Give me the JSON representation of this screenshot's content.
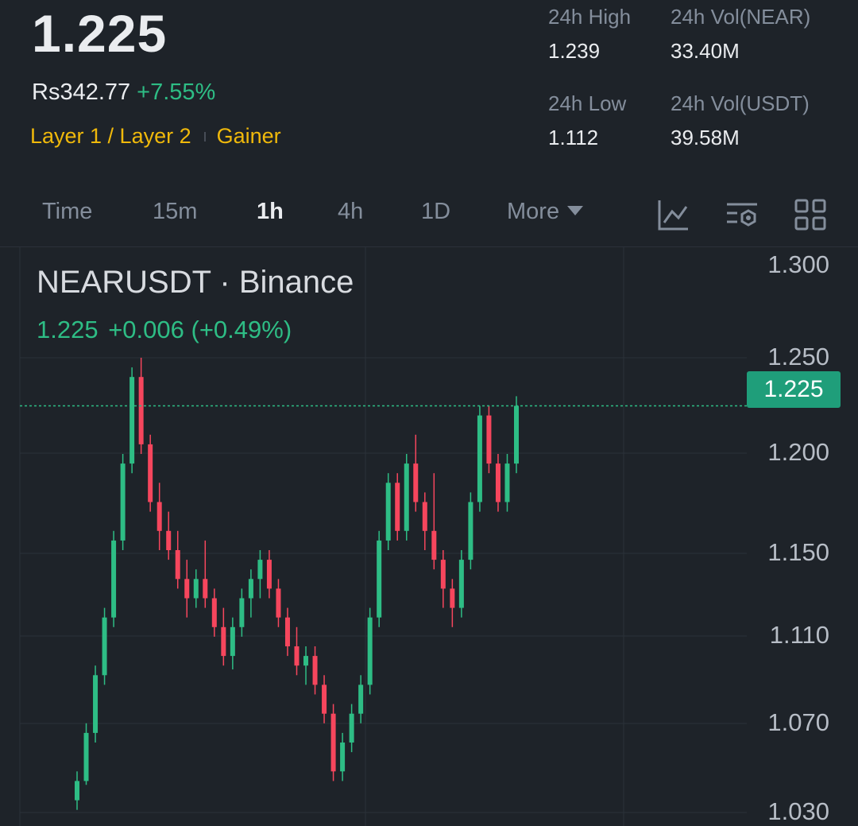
{
  "header": {
    "last_price": "1.225",
    "local_price": "Rs342.77",
    "change_pct": "+7.55%",
    "tag_1": "Layer 1 / Layer 2",
    "tag_2": "Gainer",
    "stats": {
      "high_label": "24h High",
      "high_value": "1.239",
      "vol_near_label": "24h Vol(NEAR)",
      "vol_near_value": "33.40M",
      "low_label": "24h Low",
      "low_value": "1.112",
      "vol_usdt_label": "24h Vol(USDT)",
      "vol_usdt_value": "39.58M"
    }
  },
  "tabs": {
    "time": "Time",
    "m15": "15m",
    "h1": "1h",
    "h4": "4h",
    "d1": "1D",
    "more": "More",
    "active": "1h",
    "icons": [
      "indicator-line-icon",
      "chart-settings-icon",
      "grid-layout-icon"
    ]
  },
  "chart": {
    "symbol_title": "NEARUSDT · Binance",
    "legend_price": "1.225",
    "legend_change": "+0.006 (+0.49%)",
    "current_price_tag": "1.225",
    "colors": {
      "up": "#2ebd85",
      "down": "#f6465d",
      "grid": "#2b3139",
      "price_line": "#2ebd85"
    }
  },
  "chart_data": {
    "type": "candlestick",
    "title": "NEARUSDT · Binance",
    "interval": "1h",
    "y_tick_labels": [
      "1.300",
      "1.250",
      "1.200",
      "1.150",
      "1.110",
      "1.070",
      "1.030"
    ],
    "ylim": [
      1.02,
      1.3
    ],
    "current_price": 1.225,
    "grid": true,
    "candles": [
      {
        "o": 1.02,
        "h": 1.035,
        "l": 1.015,
        "c": 1.03
      },
      {
        "o": 1.03,
        "h": 1.06,
        "l": 1.028,
        "c": 1.055
      },
      {
        "o": 1.055,
        "h": 1.09,
        "l": 1.05,
        "c": 1.085
      },
      {
        "o": 1.085,
        "h": 1.12,
        "l": 1.08,
        "c": 1.115
      },
      {
        "o": 1.115,
        "h": 1.16,
        "l": 1.11,
        "c": 1.155
      },
      {
        "o": 1.155,
        "h": 1.2,
        "l": 1.15,
        "c": 1.195
      },
      {
        "o": 1.195,
        "h": 1.245,
        "l": 1.19,
        "c": 1.24
      },
      {
        "o": 1.24,
        "h": 1.25,
        "l": 1.2,
        "c": 1.205
      },
      {
        "o": 1.205,
        "h": 1.21,
        "l": 1.17,
        "c": 1.175
      },
      {
        "o": 1.175,
        "h": 1.185,
        "l": 1.15,
        "c": 1.16
      },
      {
        "o": 1.16,
        "h": 1.17,
        "l": 1.145,
        "c": 1.15
      },
      {
        "o": 1.15,
        "h": 1.16,
        "l": 1.13,
        "c": 1.135
      },
      {
        "o": 1.135,
        "h": 1.145,
        "l": 1.115,
        "c": 1.125
      },
      {
        "o": 1.125,
        "h": 1.14,
        "l": 1.12,
        "c": 1.135
      },
      {
        "o": 1.135,
        "h": 1.155,
        "l": 1.12,
        "c": 1.125
      },
      {
        "o": 1.125,
        "h": 1.13,
        "l": 1.105,
        "c": 1.11
      },
      {
        "o": 1.11,
        "h": 1.12,
        "l": 1.09,
        "c": 1.095
      },
      {
        "o": 1.095,
        "h": 1.115,
        "l": 1.088,
        "c": 1.11
      },
      {
        "o": 1.11,
        "h": 1.13,
        "l": 1.105,
        "c": 1.125
      },
      {
        "o": 1.125,
        "h": 1.14,
        "l": 1.115,
        "c": 1.135
      },
      {
        "o": 1.135,
        "h": 1.15,
        "l": 1.125,
        "c": 1.145
      },
      {
        "o": 1.145,
        "h": 1.15,
        "l": 1.125,
        "c": 1.13
      },
      {
        "o": 1.13,
        "h": 1.135,
        "l": 1.11,
        "c": 1.115
      },
      {
        "o": 1.115,
        "h": 1.12,
        "l": 1.095,
        "c": 1.1
      },
      {
        "o": 1.1,
        "h": 1.11,
        "l": 1.085,
        "c": 1.09
      },
      {
        "o": 1.09,
        "h": 1.1,
        "l": 1.08,
        "c": 1.095
      },
      {
        "o": 1.095,
        "h": 1.1,
        "l": 1.075,
        "c": 1.08
      },
      {
        "o": 1.08,
        "h": 1.085,
        "l": 1.06,
        "c": 1.065
      },
      {
        "o": 1.065,
        "h": 1.07,
        "l": 1.03,
        "c": 1.035
      },
      {
        "o": 1.035,
        "h": 1.055,
        "l": 1.03,
        "c": 1.05
      },
      {
        "o": 1.05,
        "h": 1.07,
        "l": 1.045,
        "c": 1.065
      },
      {
        "o": 1.065,
        "h": 1.085,
        "l": 1.06,
        "c": 1.08
      },
      {
        "o": 1.08,
        "h": 1.12,
        "l": 1.075,
        "c": 1.115
      },
      {
        "o": 1.115,
        "h": 1.16,
        "l": 1.11,
        "c": 1.155
      },
      {
        "o": 1.155,
        "h": 1.19,
        "l": 1.15,
        "c": 1.185
      },
      {
        "o": 1.185,
        "h": 1.19,
        "l": 1.155,
        "c": 1.16
      },
      {
        "o": 1.16,
        "h": 1.2,
        "l": 1.155,
        "c": 1.195
      },
      {
        "o": 1.195,
        "h": 1.21,
        "l": 1.17,
        "c": 1.175
      },
      {
        "o": 1.175,
        "h": 1.18,
        "l": 1.15,
        "c": 1.16
      },
      {
        "o": 1.16,
        "h": 1.19,
        "l": 1.14,
        "c": 1.145
      },
      {
        "o": 1.145,
        "h": 1.15,
        "l": 1.12,
        "c": 1.13
      },
      {
        "o": 1.13,
        "h": 1.135,
        "l": 1.11,
        "c": 1.12
      },
      {
        "o": 1.12,
        "h": 1.15,
        "l": 1.115,
        "c": 1.145
      },
      {
        "o": 1.145,
        "h": 1.18,
        "l": 1.14,
        "c": 1.175
      },
      {
        "o": 1.175,
        "h": 1.225,
        "l": 1.17,
        "c": 1.22
      },
      {
        "o": 1.22,
        "h": 1.225,
        "l": 1.19,
        "c": 1.195
      },
      {
        "o": 1.195,
        "h": 1.2,
        "l": 1.17,
        "c": 1.175
      },
      {
        "o": 1.175,
        "h": 1.2,
        "l": 1.17,
        "c": 1.195
      },
      {
        "o": 1.195,
        "h": 1.23,
        "l": 1.19,
        "c": 1.225
      }
    ]
  }
}
